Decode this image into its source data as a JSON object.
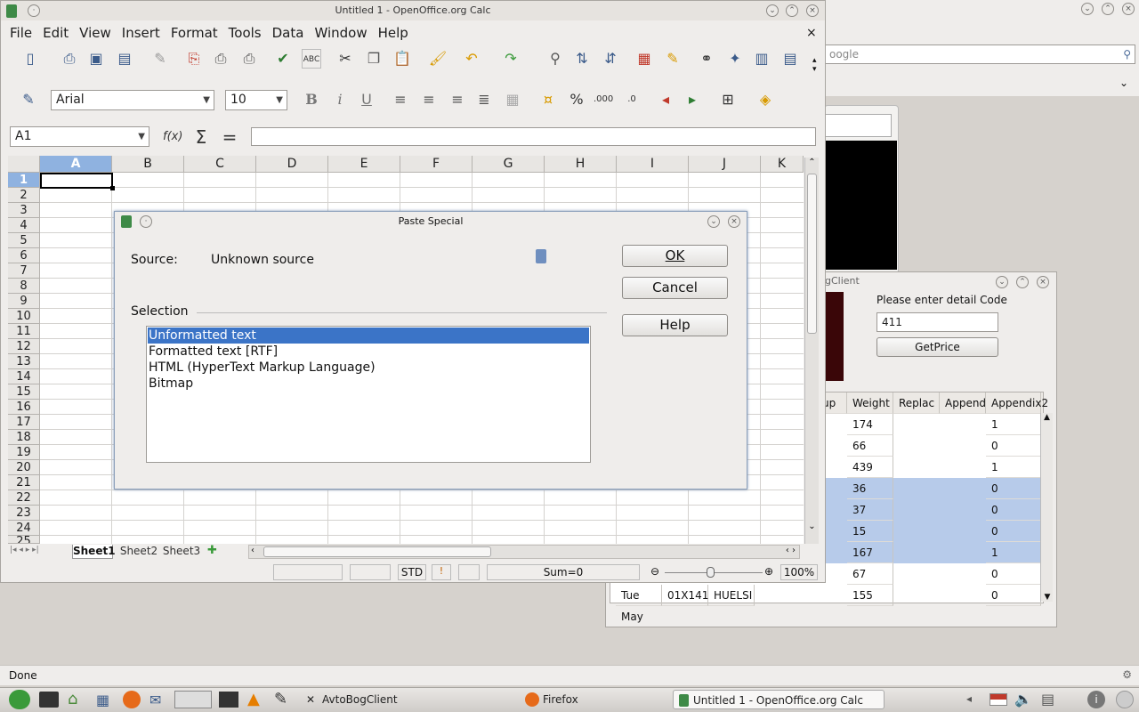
{
  "calc": {
    "title": "Untitled 1 - OpenOffice.org Calc",
    "menus": [
      "File",
      "Edit",
      "View",
      "Insert",
      "Format",
      "Tools",
      "Data",
      "Window",
      "Help"
    ],
    "font_name": "Arial",
    "font_size": "10",
    "name_box": "A1",
    "columns": [
      "A",
      "B",
      "C",
      "D",
      "E",
      "F",
      "G",
      "H",
      "I",
      "J",
      "K"
    ],
    "rows": [
      "1",
      "2",
      "3",
      "4",
      "5",
      "6",
      "7",
      "8",
      "9",
      "10",
      "11",
      "12",
      "13",
      "14",
      "15",
      "16",
      "17",
      "18",
      "19",
      "20",
      "21",
      "22",
      "23",
      "24",
      "25"
    ],
    "sheets": [
      "Sheet1",
      "Sheet2",
      "Sheet3"
    ],
    "status": {
      "mode": "STD",
      "sum": "Sum=0",
      "zoom": "100%"
    }
  },
  "dialog": {
    "title": "Paste Special",
    "source_label": "Source:",
    "source_value": "Unknown source",
    "selection_label": "Selection",
    "options": [
      "Unformatted text",
      "Formatted text [RTF]",
      "HTML (HyperText Markup Language)",
      "Bitmap"
    ],
    "selected_index": 0,
    "ok": "OK",
    "cancel": "Cancel",
    "help": "Help"
  },
  "browser": {
    "search_placeholder": "oogle"
  },
  "client": {
    "title_fragment": "gClient",
    "prompt": "Please enter detail Code",
    "code": "411",
    "get_price": "GetPrice",
    "headers": [
      "up",
      "Weight",
      "Replac",
      "Append",
      "Appendix2"
    ],
    "weights": [
      "174",
      "66",
      "439",
      "36",
      "37",
      "15",
      "167",
      "67",
      "155"
    ],
    "appendix": [
      "1",
      "0",
      "1",
      "0",
      "0",
      "0",
      "1",
      "0",
      "0"
    ],
    "last_row": [
      "Tue May",
      "01X141",
      "HUELSI"
    ]
  },
  "status_bar": {
    "text": "Done"
  },
  "taskbar": {
    "items": [
      "AvtoBogClient",
      "Firefox",
      "Untitled 1 - OpenOffice.org Calc"
    ]
  },
  "colors": {
    "selection": "#3b74c7",
    "row_highlight": "#b7cbea",
    "desktop": "#d6d2cd"
  }
}
